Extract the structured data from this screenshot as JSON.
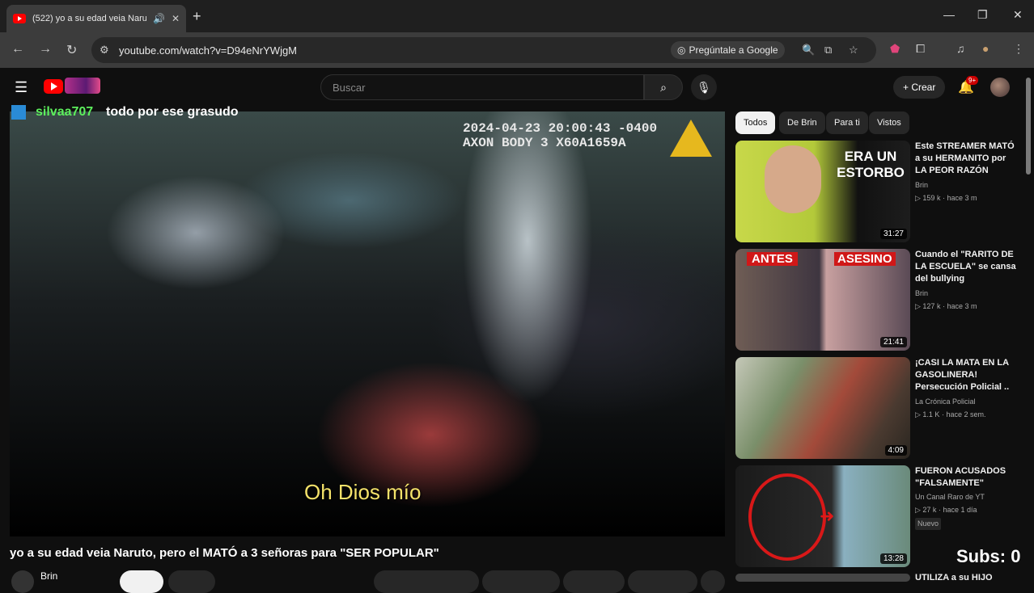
{
  "browser": {
    "tab_title": "(522) yo a su edad veia Naru",
    "url": "youtube.com/watch?v=D94eNrYWjgM",
    "ask_google": "Pregúntale a Google"
  },
  "header": {
    "search_placeholder": "Buscar",
    "create_label": "Crear",
    "notif_count": "9+"
  },
  "overlay": {
    "chat_user": "silvaa707",
    "chat_message": "todo por ese grasudo",
    "bodycam_line1": "2024-04-23 20:00:43 -0400",
    "bodycam_line2": "AXON BODY 3  X60A1659A",
    "subtitle": "Oh Dios mío",
    "subs_counter": "Subs: 0"
  },
  "video": {
    "title": "yo a su edad veia Naruto, pero el MATÓ a 3 señoras para \"SER POPULAR\"",
    "channel": "Brin"
  },
  "chips": [
    "Todos",
    "De Brin",
    "Para ti",
    "Vistos"
  ],
  "related": [
    {
      "title": "Este STREAMER MATÓ a su HERMANITO por LA PEOR RAZÓN",
      "channel": "Brin",
      "views": "159 k",
      "age": "hace 3 m",
      "duration": "31:27",
      "thumb_text": [
        "ERA UN",
        "ESTORBO"
      ]
    },
    {
      "title": "Cuando el \"RARITO DE LA ESCUELA\" se cansa del bullying",
      "channel": "Brin",
      "views": "127 k",
      "age": "hace 3 m",
      "duration": "21:41",
      "thumb_text": [
        "ANTES",
        "ASESINO"
      ]
    },
    {
      "title": "¡CASI LA MATA EN LA GASOLINERA! Persecución Policial ..",
      "channel": "La Crónica Policial",
      "views": "1.1 K",
      "age": "hace 2 sem.",
      "duration": "4:09"
    },
    {
      "title": "FUERON ACUSADOS \"FALSAMENTE\"",
      "channel": "Un Canal Raro de YT",
      "views": "27 k",
      "age": "hace 1 día",
      "duration": "13:28",
      "badge": "Nuevo"
    },
    {
      "title": "UTILIZA a su HIJO"
    }
  ]
}
